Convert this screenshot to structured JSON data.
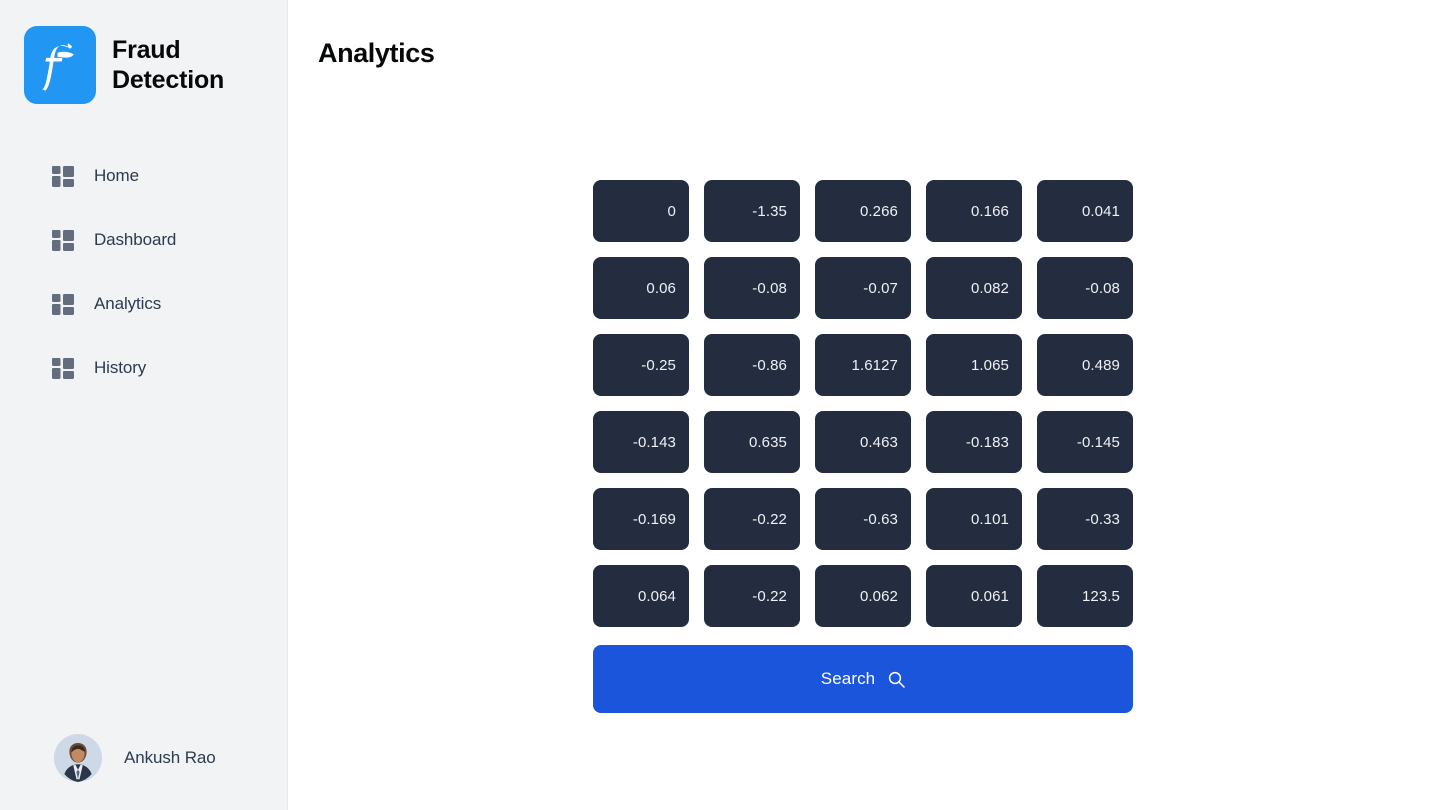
{
  "brand": {
    "name": "Fraud Detection",
    "logo_glyph": "F",
    "logo_color": "#2196f3",
    "logo_icon": "script-f-logo-icon"
  },
  "sidebar": {
    "items": [
      {
        "label": "Home",
        "icon": "grid-dashboard-icon"
      },
      {
        "label": "Dashboard",
        "icon": "grid-dashboard-icon"
      },
      {
        "label": "Analytics",
        "icon": "grid-dashboard-icon"
      },
      {
        "label": "History",
        "icon": "grid-dashboard-icon"
      }
    ],
    "user": {
      "name": "Ankush Rao",
      "avatar_icon": "user-photo-avatar"
    }
  },
  "header": {
    "title": "Analytics"
  },
  "main": {
    "grid": {
      "columns": 5,
      "rows": 6,
      "cell_bg": "#232d3f",
      "cell_text_color": "#eef1f5",
      "values": [
        [
          "0",
          "-1.35",
          "0.266",
          "0.166",
          "0.041"
        ],
        [
          "0.06",
          "-0.08",
          "-0.07",
          "0.082",
          "-0.08"
        ],
        [
          "-0.25",
          "-0.86",
          "1.6127",
          "1.065",
          "0.489"
        ],
        [
          "-0.143",
          "0.635",
          "0.463",
          "-0.183",
          "-0.145"
        ],
        [
          "-0.169",
          "-0.22",
          "-0.63",
          "0.101",
          "-0.33"
        ],
        [
          "0.064",
          "-0.22",
          "0.062",
          "0.061",
          "123.5"
        ]
      ]
    },
    "search_button": {
      "label": "Search",
      "icon": "search-magnifier-icon",
      "color": "#1b55dc"
    }
  }
}
